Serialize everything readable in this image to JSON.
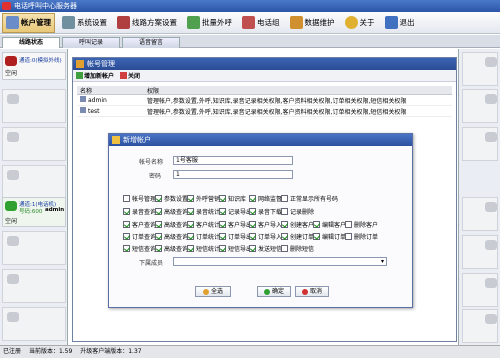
{
  "window_title": "电话呼叫中心服务器",
  "toolbar": [
    {
      "label": "帐户管理",
      "icon": "account-icon",
      "color": "#6a8cc8",
      "active": true
    },
    {
      "label": "系统设置",
      "icon": "settings-icon",
      "color": "#7090a0"
    },
    {
      "label": "线路方案设置",
      "icon": "line-plan-icon",
      "color": "#b04040"
    },
    {
      "label": "批量外呼",
      "icon": "batch-call-icon",
      "color": "#50a050"
    },
    {
      "label": "电话组",
      "icon": "phone-group-icon",
      "color": "#c05050"
    },
    {
      "label": "数据维护",
      "icon": "data-icon",
      "color": "#d09030"
    },
    {
      "label": "关于",
      "icon": "about-icon",
      "color": "#e0b030"
    },
    {
      "label": "退出",
      "icon": "exit-icon",
      "color": "#4070c0"
    }
  ],
  "tabs": [
    "线路状态",
    "呼叫记录",
    "语音留言"
  ],
  "agents": [
    {
      "title": "通道:0(模拟外线)",
      "status": "空闲"
    },
    {
      "title": "通道:1(电话机)",
      "number": "号码:600",
      "user": "admin",
      "status": "空闲"
    }
  ],
  "account_window": {
    "title": "帐号管理",
    "add_label": "增加新帐户",
    "close_label": "关闭",
    "columns": [
      "名称",
      "权限"
    ],
    "rows": [
      {
        "name": "admin",
        "perm": "管理帐户,参数设置,外呼,知识库,录音记录相关权限,客户资料相关权限,订单相关权限,短信相关权限"
      },
      {
        "name": "test",
        "perm": "管理帐户,参数设置,外呼,知识库,录音记录相关权限,客户资料相关权限,订单相关权限,短信相关权限"
      }
    ]
  },
  "dialog": {
    "title": "新增帐户",
    "account_name_label": "帐号名称",
    "account_name_value": "1号客服",
    "password_label": "密码",
    "password_value": "1",
    "checkboxes": [
      [
        {
          "label": "帐号管理",
          "on": false
        },
        {
          "label": "参数设置",
          "on": true
        },
        {
          "label": "外呼营销",
          "on": true
        },
        {
          "label": "知识库",
          "on": true
        },
        {
          "label": "网络监督",
          "on": true
        },
        {
          "label": "正常显示所有号码",
          "on": false
        }
      ],
      [
        {
          "label": "录音查询",
          "on": true
        },
        {
          "label": "高级查询",
          "on": true
        },
        {
          "label": "录音统计",
          "on": true
        },
        {
          "label": "记录导出",
          "on": true
        },
        {
          "label": "录音下载",
          "on": true
        },
        {
          "label": "记录删除",
          "on": false
        }
      ],
      [
        {
          "label": "客户查询",
          "on": true
        },
        {
          "label": "高级查询",
          "on": true
        },
        {
          "label": "客户统计",
          "on": true
        },
        {
          "label": "客户导出",
          "on": true
        },
        {
          "label": "客户导入",
          "on": true
        },
        {
          "label": "创建客户",
          "on": true
        },
        {
          "label": "编辑客户",
          "on": true
        },
        {
          "label": "删除客户",
          "on": false
        }
      ],
      [
        {
          "label": "订单查询",
          "on": true
        },
        {
          "label": "高级查询",
          "on": true
        },
        {
          "label": "订单统计",
          "on": true
        },
        {
          "label": "订单导出",
          "on": true
        },
        {
          "label": "订单导入",
          "on": true
        },
        {
          "label": "创建订单",
          "on": true
        },
        {
          "label": "编辑订单",
          "on": true
        },
        {
          "label": "删除订单",
          "on": false
        }
      ],
      [
        {
          "label": "短信查询",
          "on": true
        },
        {
          "label": "高级查询",
          "on": true
        },
        {
          "label": "短信统计",
          "on": true
        },
        {
          "label": "短信导出",
          "on": true
        },
        {
          "label": "发送短信",
          "on": true
        },
        {
          "label": "删除短信",
          "on": false
        }
      ]
    ],
    "subordinate_label": "下属成员",
    "select_all_label": "全选",
    "ok_label": "确定",
    "cancel_label": "取消"
  },
  "status": {
    "registered": "已注册",
    "version": "当前版本：1.59",
    "upgrade": "升级客户端版本：1.37"
  }
}
